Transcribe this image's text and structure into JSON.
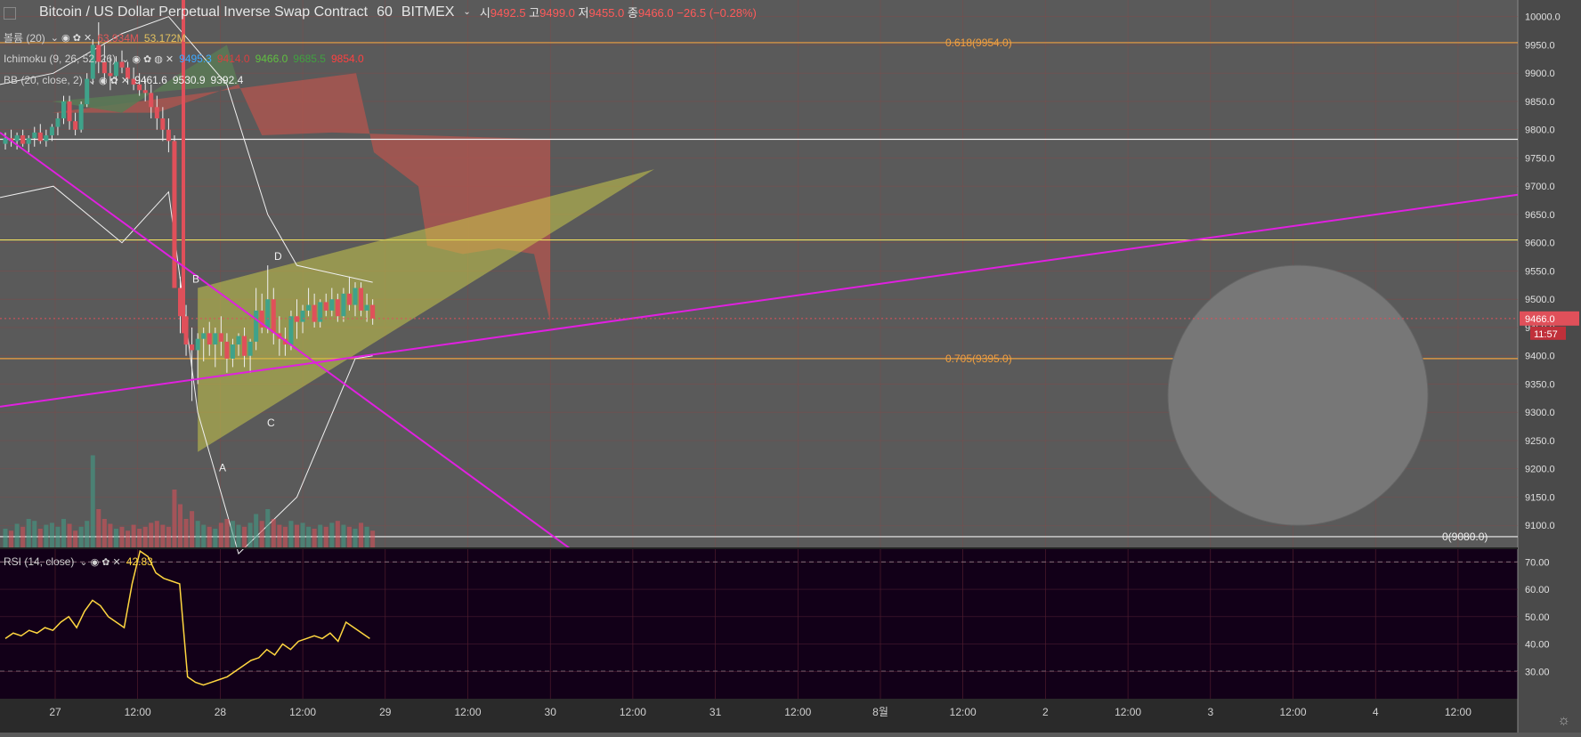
{
  "header": {
    "symbol_title": "Bitcoin / US Dollar Perpetual Inverse Swap Contract",
    "interval": "60",
    "exchange": "BITMEX",
    "open_label": "시",
    "open_value": "9492.5",
    "high_label": "고",
    "high_value": "9499.0",
    "low_label": "저",
    "low_value": "9455.0",
    "close_label": "종",
    "close_value": "9466.0",
    "change": "−26.5 (−0.28%)"
  },
  "indicators": {
    "volume": {
      "label": "볼륨 (20)",
      "v1": "63.934M",
      "v2": "53.172M"
    },
    "ichimoku": {
      "label": "Ichimoku (9, 26, 52, 26)",
      "v1": "9495.3",
      "v2": "9414.0",
      "v3": "9466.0",
      "v4": "9685.5",
      "v5": "9854.0"
    },
    "bb": {
      "label": "BB (20, close, 2)",
      "v1": "9461.6",
      "v2": "9530.9",
      "v3": "9392.4"
    },
    "rsi": {
      "label": "RSI (14, close)",
      "value": "42.83"
    }
  },
  "colors": {
    "bg": "#5a5a5a",
    "rsi_bg": "#120018",
    "up": "#3fa28a",
    "down": "#e0505a",
    "magenta": "#e020e0",
    "yellow_line": "#f0e060",
    "fib": "#f0a040",
    "rsi_line": "#ffd640",
    "cloud_red": "#b4554f",
    "cloud_green": "#5a7a56",
    "triangle": "#c8c84a"
  },
  "chart_data": [
    {
      "type": "line",
      "title": "Bitcoin / US Dollar Perpetual Inverse Swap Contract",
      "ylim": [
        9050,
        10020
      ],
      "y_ticks": [
        "10000.0",
        "9950.0",
        "9900.0",
        "9850.0",
        "9800.0",
        "9750.0",
        "9700.0",
        "9650.0",
        "9600.0",
        "9550.0",
        "9500.0",
        "9450.0",
        "9400.0",
        "9350.0",
        "9300.0",
        "9250.0",
        "9200.0",
        "9150.0",
        "9100.0"
      ],
      "x_ticks": [
        "27",
        "12:00",
        "28",
        "12:00",
        "29",
        "12:00",
        "30",
        "12:00",
        "31",
        "12:00",
        "8월",
        "12:00",
        "2",
        "12:00",
        "3",
        "12:00",
        "4",
        "12:00"
      ],
      "last_price": "9466.0",
      "countdown": "11:57",
      "hlines": [
        {
          "price": 9954,
          "label": "0.618(9954.0)",
          "color": "fib"
        },
        {
          "price": 9395,
          "label": "0.705(9395.0)",
          "color": "fib"
        },
        {
          "price": 9080,
          "label": "0(9080.0)",
          "color": "white"
        },
        {
          "price": 9783,
          "label": "",
          "color": "white"
        },
        {
          "price": 9605,
          "label": "",
          "color": "yellow"
        }
      ],
      "pattern_points": [
        {
          "label": "A",
          "price": 9230
        },
        {
          "label": "B",
          "price": 9520
        },
        {
          "label": "C",
          "price": 9310
        },
        {
          "label": "D",
          "price": 9560
        }
      ],
      "candles": [
        [
          9775,
          9795,
          9765,
          9785
        ],
        [
          9785,
          9800,
          9770,
          9780
        ],
        [
          9780,
          9795,
          9765,
          9790
        ],
        [
          9790,
          9800,
          9770,
          9775
        ],
        [
          9775,
          9790,
          9760,
          9785
        ],
        [
          9785,
          9805,
          9770,
          9795
        ],
        [
          9795,
          9810,
          9775,
          9780
        ],
        [
          9780,
          9800,
          9770,
          9790
        ],
        [
          9790,
          9810,
          9780,
          9805
        ],
        [
          9805,
          9830,
          9790,
          9820
        ],
        [
          9820,
          9860,
          9810,
          9850
        ],
        [
          9850,
          9860,
          9800,
          9815
        ],
        [
          9815,
          9830,
          9790,
          9800
        ],
        [
          9800,
          9850,
          9795,
          9845
        ],
        [
          9845,
          9900,
          9840,
          9890
        ],
        [
          9890,
          9960,
          9880,
          9950
        ],
        [
          9950,
          9990,
          9900,
          9920
        ],
        [
          9920,
          9950,
          9880,
          9900
        ],
        [
          9900,
          9930,
          9870,
          9895
        ],
        [
          9895,
          9930,
          9880,
          9920
        ],
        [
          9920,
          9940,
          9900,
          9910
        ],
        [
          9910,
          9920,
          9880,
          9890
        ],
        [
          9890,
          9910,
          9870,
          9880
        ],
        [
          9880,
          9900,
          9860,
          9870
        ],
        [
          9870,
          9890,
          9850,
          9865
        ],
        [
          9865,
          9880,
          9820,
          9840
        ],
        [
          9840,
          9860,
          9800,
          9820
        ],
        [
          9820,
          9840,
          9780,
          9800
        ],
        [
          9800,
          9820,
          9760,
          9780
        ],
        [
          9780,
          9790,
          9700,
          9520
        ],
        [
          9520,
          9540,
          9440,
          9470
        ],
        [
          9470,
          9490,
          9400,
          9420
        ],
        [
          9420,
          9450,
          9320,
          9410
        ],
        [
          9410,
          9440,
          9350,
          9430
        ],
        [
          9430,
          9450,
          9390,
          9440
        ],
        [
          9440,
          9460,
          9400,
          9420
        ],
        [
          9420,
          9450,
          9380,
          9440
        ],
        [
          9440,
          9470,
          9400,
          9425
        ],
        [
          9425,
          9440,
          9370,
          9395
        ],
        [
          9395,
          9430,
          9380,
          9420
        ],
        [
          9420,
          9440,
          9400,
          9435
        ],
        [
          9435,
          9450,
          9380,
          9400
        ],
        [
          9400,
          9430,
          9370,
          9425
        ],
        [
          9425,
          9520,
          9410,
          9480
        ],
        [
          9480,
          9510,
          9440,
          9450
        ],
        [
          9450,
          9560,
          9440,
          9500
        ],
        [
          9500,
          9520,
          9420,
          9440
        ],
        [
          9440,
          9470,
          9400,
          9430
        ],
        [
          9430,
          9450,
          9400,
          9420
        ],
        [
          9420,
          9480,
          9410,
          9470
        ],
        [
          9470,
          9500,
          9430,
          9460
        ],
        [
          9460,
          9490,
          9440,
          9480
        ],
        [
          9480,
          9520,
          9470,
          9490
        ],
        [
          9490,
          9510,
          9450,
          9460
        ],
        [
          9460,
          9500,
          9450,
          9495
        ],
        [
          9495,
          9510,
          9470,
          9480
        ],
        [
          9480,
          9520,
          9470,
          9500
        ],
        [
          9500,
          9510,
          9460,
          9470
        ],
        [
          9470,
          9520,
          9460,
          9510
        ],
        [
          9510,
          9540,
          9480,
          9490
        ],
        [
          9490,
          9530,
          9470,
          9520
        ],
        [
          9520,
          9530,
          9470,
          9480
        ],
        [
          9480,
          9510,
          9460,
          9490
        ],
        [
          9490,
          9500,
          9455,
          9466
        ]
      ],
      "volume": [
        20,
        18,
        25,
        22,
        30,
        28,
        20,
        24,
        26,
        22,
        30,
        25,
        18,
        22,
        28,
        95,
        40,
        30,
        25,
        20,
        22,
        18,
        24,
        20,
        22,
        26,
        28,
        24,
        22,
        60,
        45,
        30,
        38,
        28,
        24,
        22,
        20,
        26,
        30,
        28,
        24,
        22,
        26,
        35,
        28,
        40,
        30,
        24,
        22,
        28,
        24,
        26,
        22,
        20,
        24,
        22,
        26,
        28,
        24,
        22,
        20,
        26,
        22,
        18
      ]
    },
    {
      "type": "line",
      "title": "RSI (14, close)",
      "ylim": [
        20,
        75
      ],
      "y_ticks": [
        "70.00",
        "60.00",
        "50.00",
        "40.00",
        "30.00"
      ],
      "bands": [
        70,
        30
      ],
      "values": [
        42,
        44,
        43,
        45,
        44,
        46,
        45,
        48,
        50,
        46,
        52,
        56,
        54,
        50,
        48,
        46,
        62,
        74,
        72,
        66,
        64,
        63,
        62,
        28,
        26,
        25,
        26,
        27,
        28,
        30,
        32,
        34,
        35,
        38,
        36,
        40,
        38,
        41,
        42,
        43,
        42,
        44,
        41,
        48,
        46,
        44,
        42
      ]
    }
  ]
}
